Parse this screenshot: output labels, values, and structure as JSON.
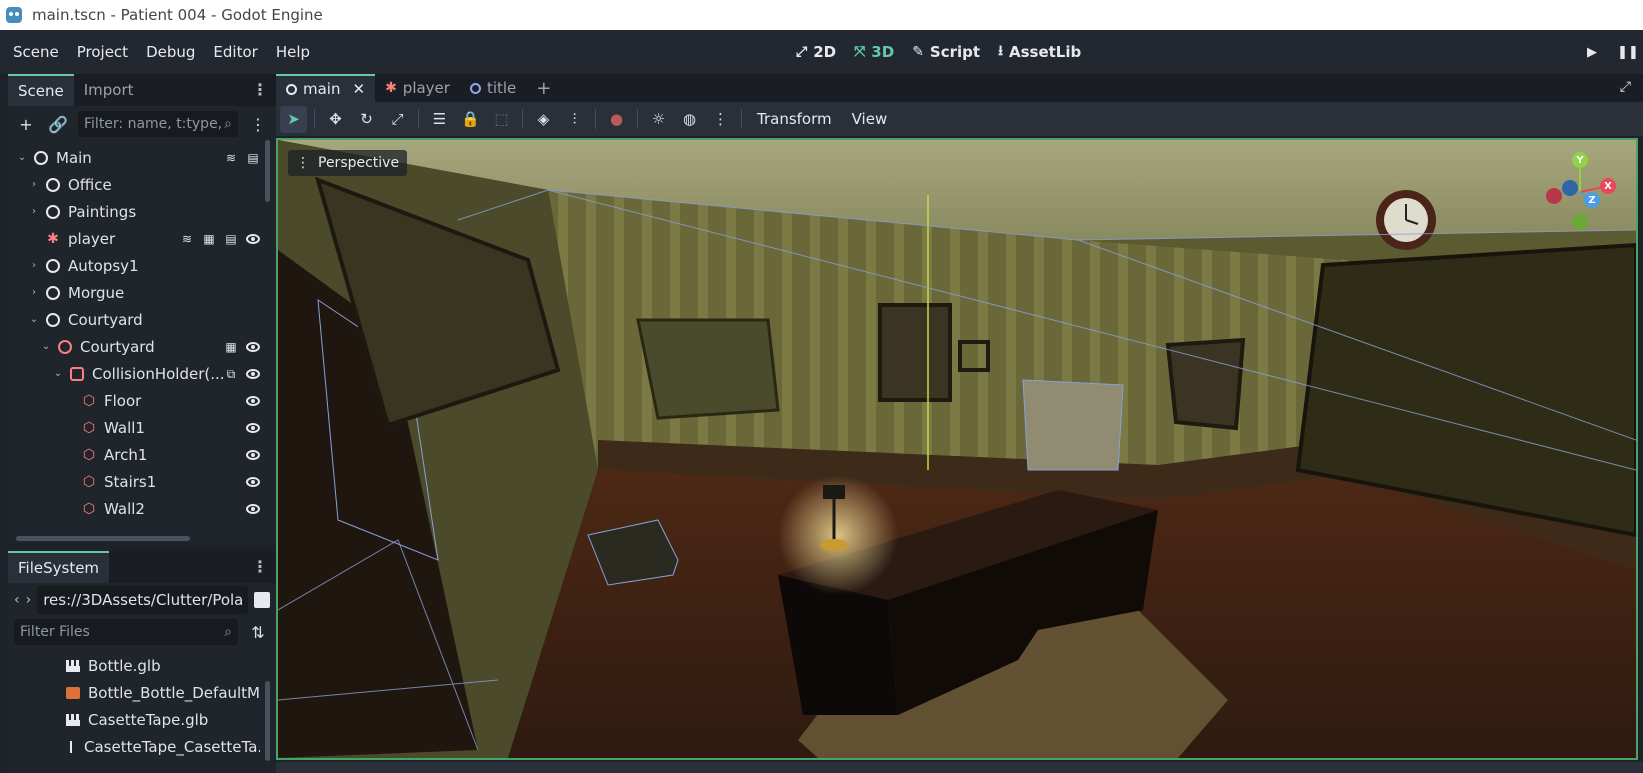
{
  "window": {
    "title": "main.tscn - Patient 004 - Godot Engine"
  },
  "menu": [
    "Scene",
    "Project",
    "Debug",
    "Editor",
    "Help"
  ],
  "workspaces": [
    {
      "label": "2D",
      "icon": "2d-icon"
    },
    {
      "label": "3D",
      "icon": "3d-icon",
      "active": true
    },
    {
      "label": "Script",
      "icon": "script-icon"
    },
    {
      "label": "AssetLib",
      "icon": "assetlib-icon"
    }
  ],
  "scene_dock": {
    "tabs": [
      "Scene",
      "Import"
    ],
    "filter_placeholder": "Filter: name, t:type,",
    "tree": [
      {
        "label": "Main",
        "indent": 0,
        "arrow": "v",
        "icon": "ring"
      },
      {
        "label": "Office",
        "indent": 1,
        "arrow": ">",
        "icon": "ring"
      },
      {
        "label": "Paintings",
        "indent": 1,
        "arrow": ">",
        "icon": "ring"
      },
      {
        "label": "player",
        "indent": 1,
        "arrow": "",
        "icon": "player"
      },
      {
        "label": "Autopsy1",
        "indent": 1,
        "arrow": ">",
        "icon": "ring"
      },
      {
        "label": "Morgue",
        "indent": 1,
        "arrow": ">",
        "icon": "ring"
      },
      {
        "label": "Courtyard",
        "indent": 1,
        "arrow": "v",
        "icon": "ring"
      },
      {
        "label": "Courtyard",
        "indent": 2,
        "arrow": "v",
        "icon": "ring-red"
      },
      {
        "label": "CollisionHolder(...",
        "indent": 3,
        "arrow": "v",
        "icon": "box-red"
      },
      {
        "label": "Floor",
        "indent": 4,
        "arrow": "",
        "icon": "cube"
      },
      {
        "label": "Wall1",
        "indent": 4,
        "arrow": "",
        "icon": "cube"
      },
      {
        "label": "Arch1",
        "indent": 4,
        "arrow": "",
        "icon": "cube"
      },
      {
        "label": "Stairs1",
        "indent": 4,
        "arrow": "",
        "icon": "cube"
      },
      {
        "label": "Wall2",
        "indent": 4,
        "arrow": "",
        "icon": "cube"
      }
    ]
  },
  "filesystem": {
    "tab": "FileSystem",
    "path": "res://3DAssets/Clutter/Pola",
    "filter_placeholder": "Filter Files",
    "items": [
      {
        "label": "Bottle.glb",
        "icon": "scene"
      },
      {
        "label": "Bottle_Bottle_DefaultM...",
        "icon": "material"
      },
      {
        "label": "CasetteTape.glb",
        "icon": "scene"
      },
      {
        "label": "CasetteTape_CasetteTa...",
        "icon": "tape"
      }
    ]
  },
  "editor_tabs": [
    {
      "label": "main",
      "active": true,
      "closable": true
    },
    {
      "label": "player",
      "icon": "player"
    },
    {
      "label": "title",
      "icon": "ring-blue"
    }
  ],
  "viewport": {
    "toolbar_menus": [
      "Transform",
      "View"
    ],
    "perspective_label": "Perspective",
    "gizmo": {
      "y": "Y",
      "x": "X",
      "z": "Z",
      "colors": {
        "x": "#e8485b",
        "y": "#8fd24b",
        "z": "#4a9ee8"
      }
    }
  },
  "colors": {
    "accent": "#63c9a6",
    "node_red": "#fc7f7f",
    "viewport_border": "#4aa366"
  }
}
